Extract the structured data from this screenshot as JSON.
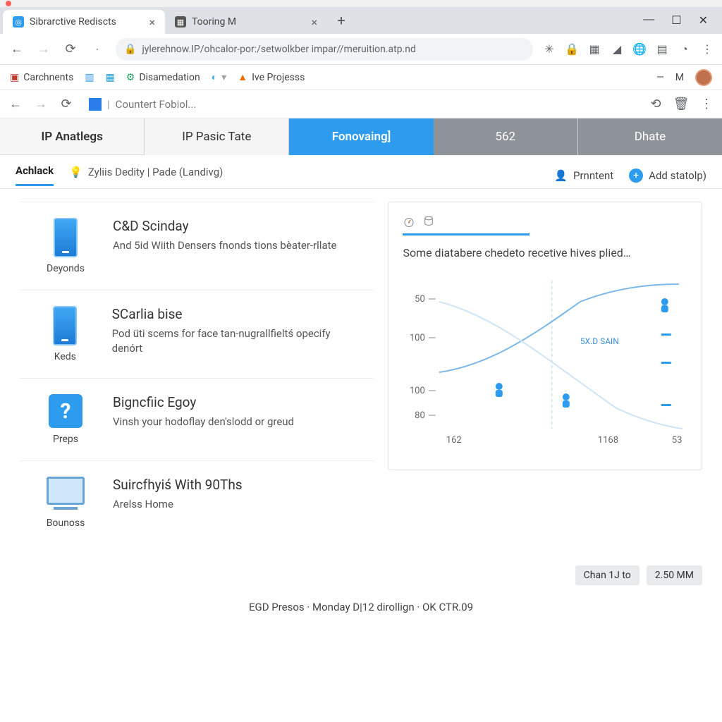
{
  "tabs": [
    {
      "title": "Sibrarctive Rediscts",
      "favicon_color": "#2d9cef",
      "active": true
    },
    {
      "title": "Tooring M",
      "favicon_color": "#4a4a4a",
      "active": false
    }
  ],
  "address_bar": {
    "url": "jylerehnow.IP/ohcalor-por:/setwolkber impar//meruition.atp.nd"
  },
  "bookmarks": [
    {
      "label": "Carchnents",
      "icon": "folder",
      "color": "#1e66d0"
    },
    {
      "label": "",
      "icon": "square",
      "color": "#2d9cef"
    },
    {
      "label": "",
      "icon": "square",
      "color": "#22a0d6"
    },
    {
      "label": "Disamedation",
      "icon": "gear",
      "color": "#1ba862"
    },
    {
      "label": "",
      "icon": "circle",
      "color": "#4db3e6"
    },
    {
      "label": "Ive Projesss",
      "icon": "warning",
      "color": "#ef6c00"
    }
  ],
  "profile_letter": "M",
  "inner_bar": {
    "search_text": "Countert Fobiol..."
  },
  "big_tabs": [
    {
      "label": "IP Anatlegs"
    },
    {
      "label": "IP Pasic Tate"
    },
    {
      "label": "Fonovaing]"
    },
    {
      "label": "562"
    },
    {
      "label": "Dhate"
    }
  ],
  "sub_tabs": {
    "active": "Achlack",
    "secondary": "Zyliis Dedity | Pade (Landivg)",
    "actions": [
      {
        "label": "Prnntent",
        "icon": "person"
      },
      {
        "label": "Add statolp)",
        "icon": "add"
      }
    ]
  },
  "cards": [
    {
      "icon": "phone",
      "icon_label": "Deyonds",
      "title": "C&D Scinday",
      "desc": "And 5id Wiith Densers fnonds tions bèater-rllate"
    },
    {
      "icon": "phone",
      "icon_label": "Keds",
      "title": "SCarlia bise",
      "desc": "Pod üti scems for face tan-nugrallfieltś opecify denórt"
    },
    {
      "icon": "question",
      "icon_label": "Preps",
      "title": "Bigncfiic Egoy",
      "desc": "Vinsh your hodoflay den'slodd or greud"
    },
    {
      "icon": "monitor",
      "icon_label": "Bounoss",
      "title": "Suircfhyiś With 90Ths",
      "desc": "Arelss Home"
    }
  ],
  "panel": {
    "desc": "Some diatabere chedeto recetive hives plied…"
  },
  "chart_data": {
    "type": "line",
    "title": "",
    "xlabel": "",
    "ylabel": "",
    "y_ticks": [
      50,
      100,
      100,
      80
    ],
    "x_ticks": [
      162,
      1168,
      53
    ],
    "annotation": "5X.D SAIN",
    "series": [
      {
        "name": "curve-up",
        "x": [
          162,
          400,
          700,
          1000,
          1168
        ],
        "y": [
          95,
          90,
          70,
          55,
          50
        ]
      },
      {
        "name": "curve-down",
        "x": [
          162,
          500,
          900,
          1168
        ],
        "y": [
          55,
          75,
          92,
          100
        ]
      }
    ],
    "markers": [
      {
        "x": 400,
        "y": 95
      },
      {
        "x": 700,
        "y": 92
      },
      {
        "x": 1100,
        "y": 55
      },
      {
        "x": 1160,
        "y": 90
      }
    ]
  },
  "pager": {
    "left": "Chan 1J to",
    "right": "2.50 MM"
  },
  "status": "EGD Presos · Monday D|12 dirollign · OK CTR.09"
}
